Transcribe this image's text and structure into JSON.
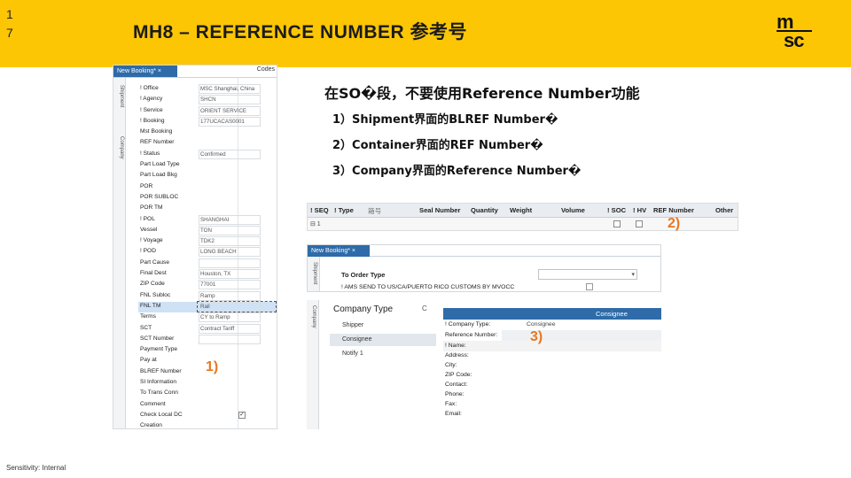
{
  "header": {
    "page_number_1": "1",
    "page_number_2": "7",
    "title": "MH8 – REFERENCE NUMBER 参考号",
    "logo_top": "m",
    "logo_bottom": "sc"
  },
  "left_form": {
    "tab_label": "New Booking*  ×",
    "codes_label": "Codes",
    "rail_shipment": "Shipment",
    "rail_company": "Company",
    "rows": [
      {
        "label": "! Office",
        "value": "MSC Shanghai, China"
      },
      {
        "label": "! Agency",
        "value": "SHCN"
      },
      {
        "label": "! Service",
        "value": "ORIENT SERVICE"
      },
      {
        "label": "! Booking",
        "value": "177UCACAS0001"
      },
      {
        "label": "Mst Booking",
        "value": ""
      },
      {
        "label": "REF Number",
        "value": ""
      },
      {
        "label": "! Status",
        "value": "Confirmed"
      },
      {
        "label": "Part Load Type",
        "value": ""
      },
      {
        "label": "Part Load Bkg",
        "value": ""
      },
      {
        "label": "POR",
        "value": ""
      },
      {
        "label": "POR SUBLOC",
        "value": ""
      },
      {
        "label": "POR TM",
        "value": ""
      },
      {
        "label": "! POL",
        "value": "SHANGHAI"
      },
      {
        "label": "Vessel",
        "value": "TON"
      },
      {
        "label": "! Voyage",
        "value": "TDK2"
      },
      {
        "label": "! POD",
        "value": "LONG BEACH"
      },
      {
        "label": "Part Cause",
        "value": ""
      },
      {
        "label": "Final Dest",
        "value": "Houston, TX"
      },
      {
        "label": "ZIP Code",
        "value": "77001"
      },
      {
        "label": "FNL Subloc",
        "value": "Ramp"
      },
      {
        "label": "FNL TM",
        "value": "Rail"
      },
      {
        "label": "Terms",
        "value": "CY to Ramp"
      },
      {
        "label": "SCT",
        "value": "Contract Tariff"
      },
      {
        "label": "SCT Number",
        "value": ""
      },
      {
        "label": "Payment Type",
        "value": ""
      },
      {
        "label": "Pay at",
        "value": ""
      },
      {
        "label": "BLREF Number",
        "value": ""
      },
      {
        "label": "SI Information",
        "value": ""
      },
      {
        "label": "To Trans Conn",
        "value": ""
      },
      {
        "label": "Comment",
        "value": ""
      },
      {
        "label": "Check Local DC",
        "value": ""
      },
      {
        "label": "Creation",
        "value": ""
      }
    ]
  },
  "annotation_1": "1)",
  "notes": {
    "title": "在SO�段，不要使用Reference Number功能",
    "items": [
      "1）Shipment界面的BLREF Number�",
      "2）Container界面的REF Number�",
      "3）Company界面的Reference Number�"
    ]
  },
  "container_grid": {
    "headers": [
      "! SEQ",
      "! Type",
      "箱号",
      "Seal Number",
      "Quantity",
      "Weight",
      "Volume",
      "! SOC",
      "! HV",
      "REF Number",
      "Other"
    ],
    "row_seq": "⊟ 1"
  },
  "annotation_2": "2)",
  "order_panel": {
    "tab_label": "New Booking*  ×",
    "rail_label": "Shipment",
    "order_type_label": "To Order Type",
    "ams_label": "! AMS SEND TO US/CA/PUERTO RICO CUSTOMS BY MVOCC",
    "select_arrow": "▾"
  },
  "company_panel": {
    "rail_label": "Company",
    "heading": "Company Type",
    "c_mark": "C",
    "items": [
      "Shipper",
      "Consignee",
      "Notify 1"
    ],
    "consignee_title": "Consignee",
    "labels": [
      "! Company Type:",
      "Reference Number:",
      "! Name:",
      "Address:",
      "City:",
      "ZIP Code:",
      "Contact:",
      "Phone:",
      "Fax:",
      "Email:"
    ],
    "company_type_value": "Consignee"
  },
  "annotation_3": "3)",
  "footer": "Sensitivity: Internal",
  "colors": {
    "header_bg": "#fcc605",
    "annotation": "#e87722",
    "tab_blue": "#2e6ba8"
  }
}
